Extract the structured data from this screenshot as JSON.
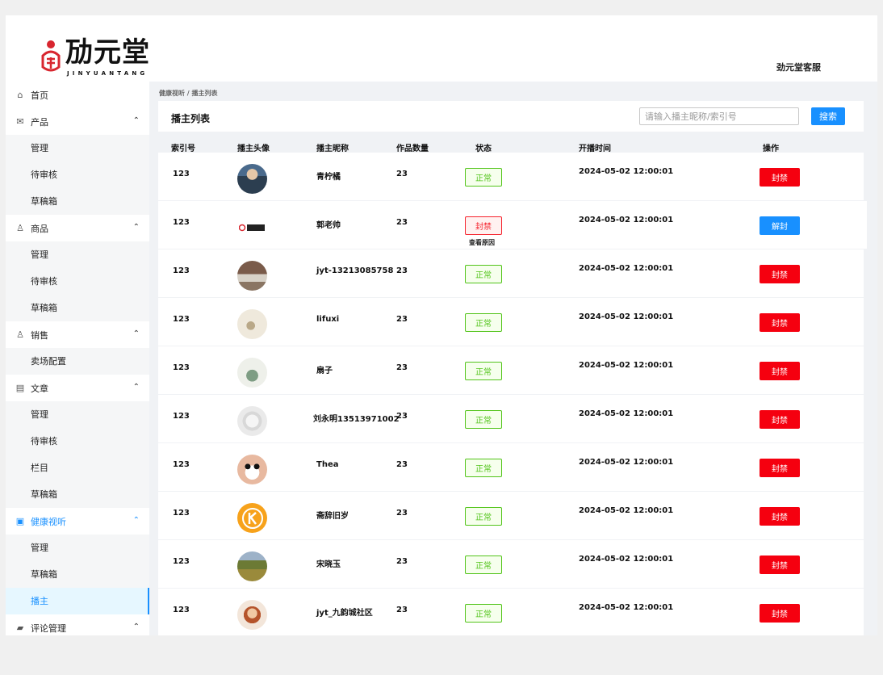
{
  "brand": {
    "logo_text": "劢元堂",
    "logo_sub": "JINYUANTANG",
    "user_name": "劲元堂客服"
  },
  "sidebar": {
    "groups": [
      {
        "label": "首页",
        "icon": "home-icon",
        "expandable": false
      },
      {
        "label": "产品",
        "icon": "mail-icon",
        "expandable": true,
        "items": [
          "管理",
          "待审核",
          "草稿箱"
        ]
      },
      {
        "label": "商品",
        "icon": "user-icon",
        "expandable": true,
        "items": [
          "管理",
          "待审核",
          "草稿箱"
        ]
      },
      {
        "label": "销售",
        "icon": "user-icon",
        "expandable": true,
        "items": [
          "卖场配置"
        ]
      },
      {
        "label": "文章",
        "icon": "document-icon",
        "expandable": true,
        "items": [
          "管理",
          "待审核",
          "栏目",
          "草稿箱"
        ]
      },
      {
        "label": "健康视听",
        "icon": "video-icon",
        "expandable": true,
        "active": true,
        "items": [
          "管理",
          "草稿箱",
          "播主"
        ],
        "selected_item": "播主"
      },
      {
        "label": "评论管理",
        "icon": "comment-icon",
        "expandable": true
      }
    ]
  },
  "breadcrumb": "健康视听 / 播主列表",
  "panel": {
    "title": "播主列表",
    "search_placeholder": "请输入播主昵称/索引号",
    "search_button": "搜索"
  },
  "table": {
    "headers": {
      "index": "索引号",
      "avatar": "播主头像",
      "nickname": "播主昵称",
      "works": "作品数量",
      "status": "状态",
      "start_time": "开播时间",
      "action": "操作"
    },
    "rows": [
      {
        "index": "123",
        "nickname": "青柠橘",
        "works": "23",
        "status": "正常",
        "status_type": "ok",
        "time": "2024-05-02 12:00:01",
        "action": "封禁"
      },
      {
        "index": "123",
        "nickname": "郭老帅",
        "works": "23",
        "status": "封禁",
        "status_type": "banned",
        "reason_link": "查看原因",
        "time": "2024-05-02 12:00:01",
        "action": "解封"
      },
      {
        "index": "123",
        "nickname": "jyt-13213085758",
        "works": "23",
        "status": "正常",
        "status_type": "ok",
        "time": "2024-05-02 12:00:01",
        "action": "封禁"
      },
      {
        "index": "123",
        "nickname": "lifuxi",
        "works": "23",
        "status": "正常",
        "status_type": "ok",
        "time": "2024-05-02 12:00:01",
        "action": "封禁"
      },
      {
        "index": "123",
        "nickname": "扇子",
        "works": "23",
        "status": "正常",
        "status_type": "ok",
        "time": "2024-05-02 12:00:01",
        "action": "封禁"
      },
      {
        "index": "123",
        "nickname": "刘永明13513971002",
        "works": "23",
        "status": "正常",
        "status_type": "ok",
        "time": "2024-05-02 12:00:01",
        "action": "封禁"
      },
      {
        "index": "123",
        "nickname": "Thea",
        "works": "23",
        "status": "正常",
        "status_type": "ok",
        "time": "2024-05-02 12:00:01",
        "action": "封禁"
      },
      {
        "index": "123",
        "nickname": "斋辞旧岁",
        "works": "23",
        "status": "正常",
        "status_type": "ok",
        "time": "2024-05-02 12:00:01",
        "action": "封禁"
      },
      {
        "index": "123",
        "nickname": "宋晓玉",
        "works": "23",
        "status": "正常",
        "status_type": "ok",
        "time": "2024-05-02 12:00:01",
        "action": "封禁"
      },
      {
        "index": "123",
        "nickname": "jyt_九韵城社区",
        "works": "23",
        "status": "正常",
        "status_type": "ok",
        "time": "2024-05-02 12:00:01",
        "action": "封禁"
      }
    ]
  },
  "colors": {
    "primary": "#1890ff",
    "danger": "#f5000f",
    "ok": "#52c41a"
  }
}
